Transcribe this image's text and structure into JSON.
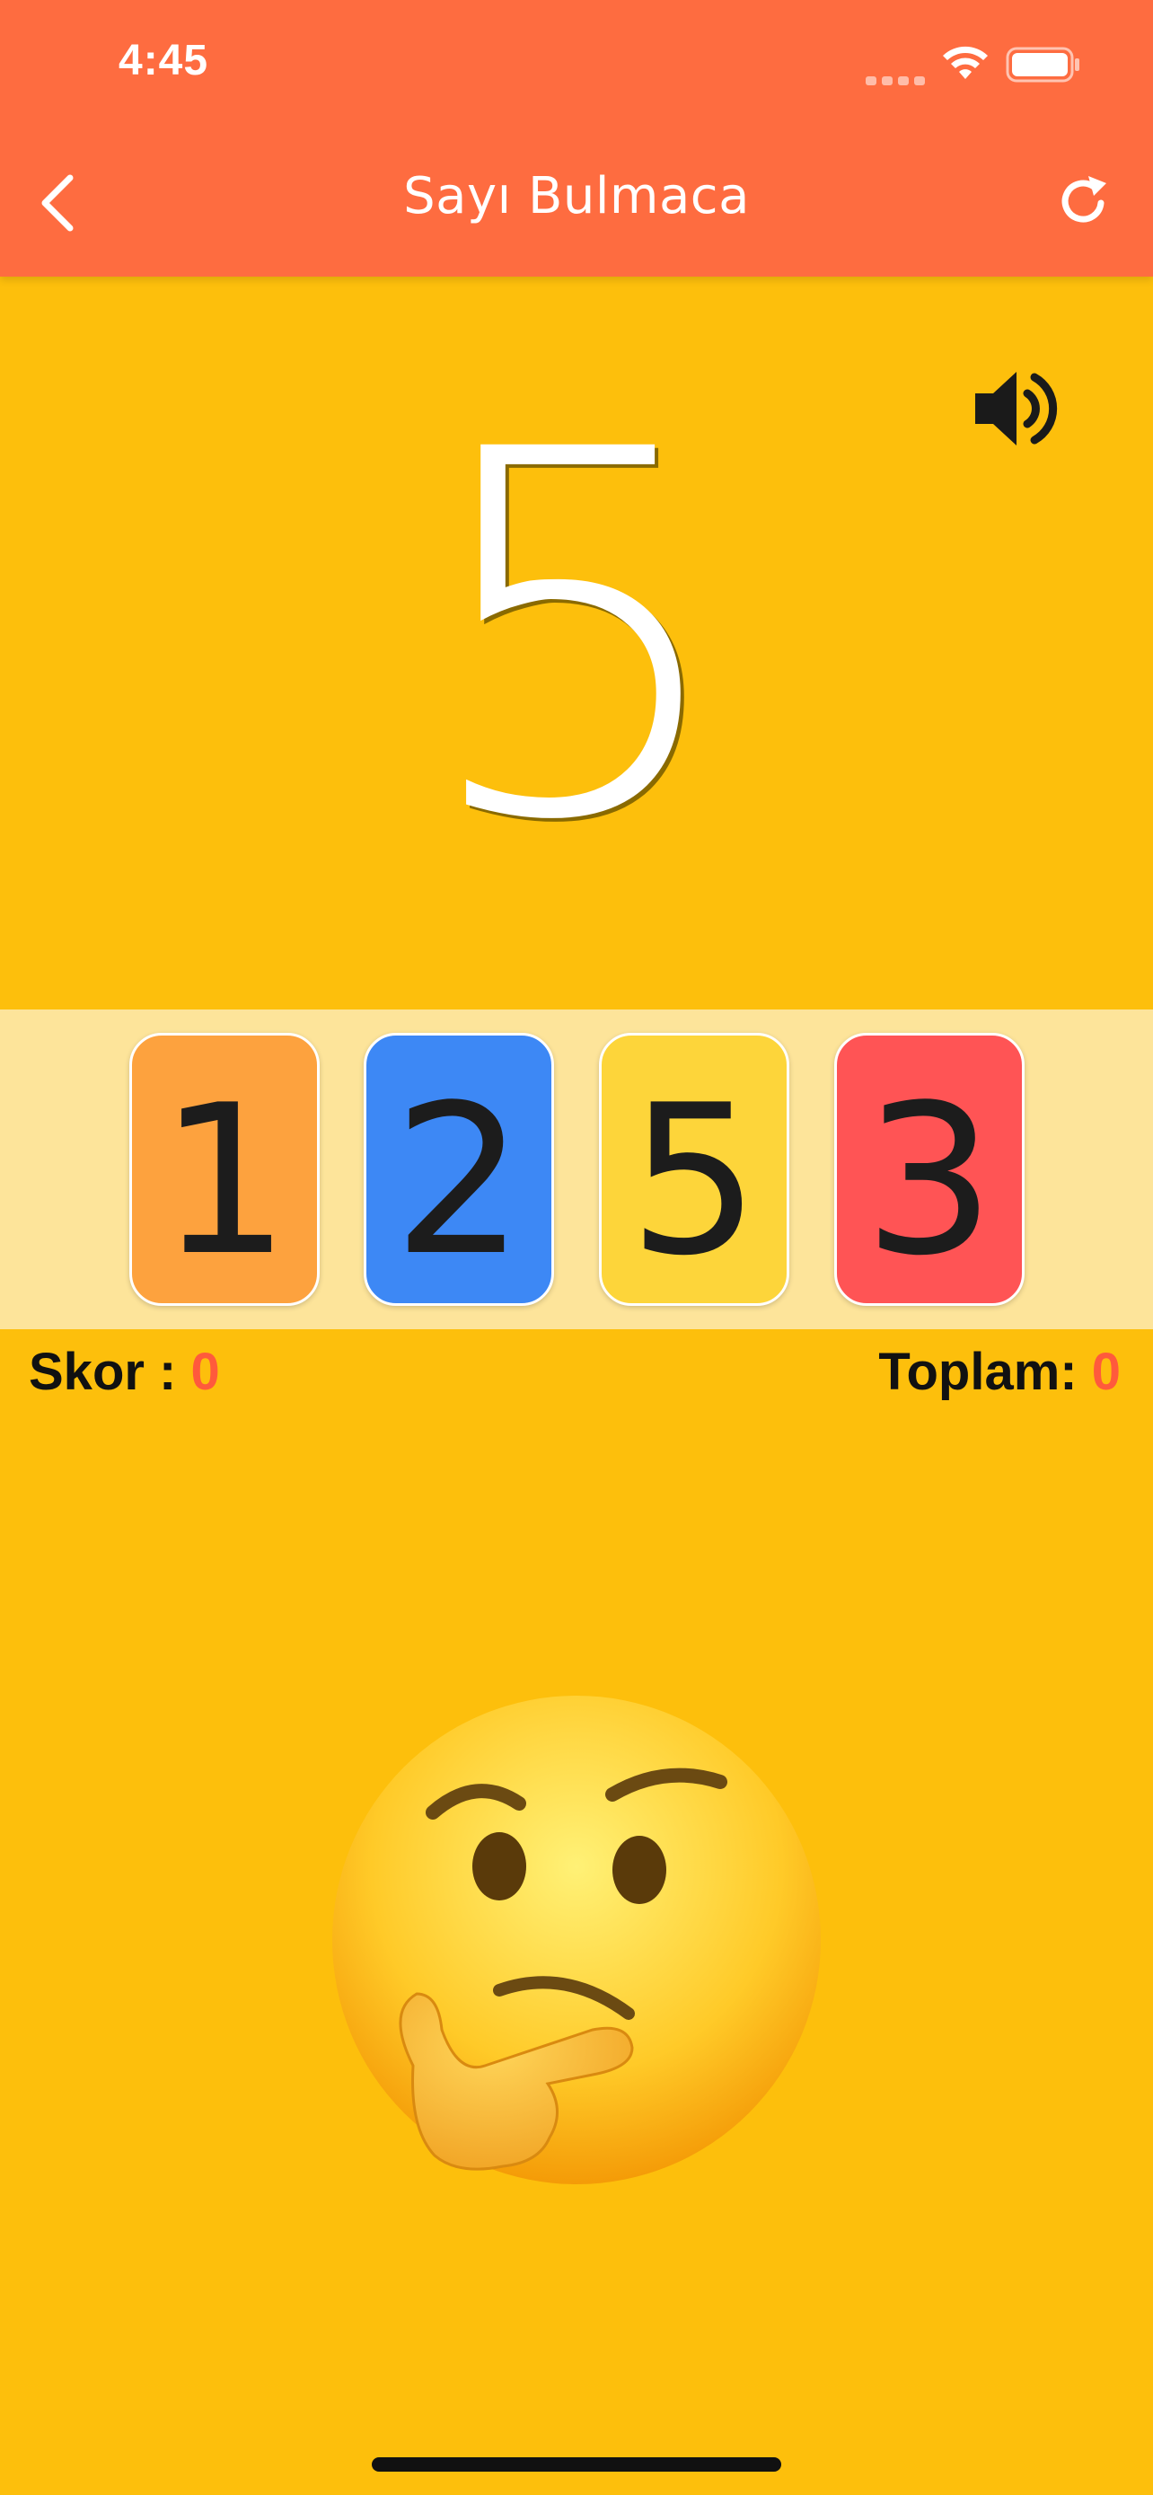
{
  "status_bar": {
    "time": "4:45"
  },
  "header": {
    "title": "Sayı Bulmaca",
    "back_icon": "chevron-left-icon",
    "refresh_icon": "refresh-icon"
  },
  "main": {
    "target_number": "5",
    "sound_icon": "speaker-icon",
    "cards": [
      {
        "value": "1",
        "color": "#FDA23E"
      },
      {
        "value": "2",
        "color": "#3D88F5"
      },
      {
        "value": "5",
        "color": "#FDD53A"
      },
      {
        "value": "3",
        "color": "#FF5455"
      }
    ],
    "score": {
      "label": "Skor :",
      "value": "0"
    },
    "total": {
      "label": "Toplam:",
      "value": "0"
    },
    "emoji": "thinking-face-icon"
  },
  "colors": {
    "header_bg": "#FE6C40",
    "page_bg": "#FDBF0C",
    "strip_bg": "#FDE49A",
    "accent_value": "#FF5A3C"
  }
}
